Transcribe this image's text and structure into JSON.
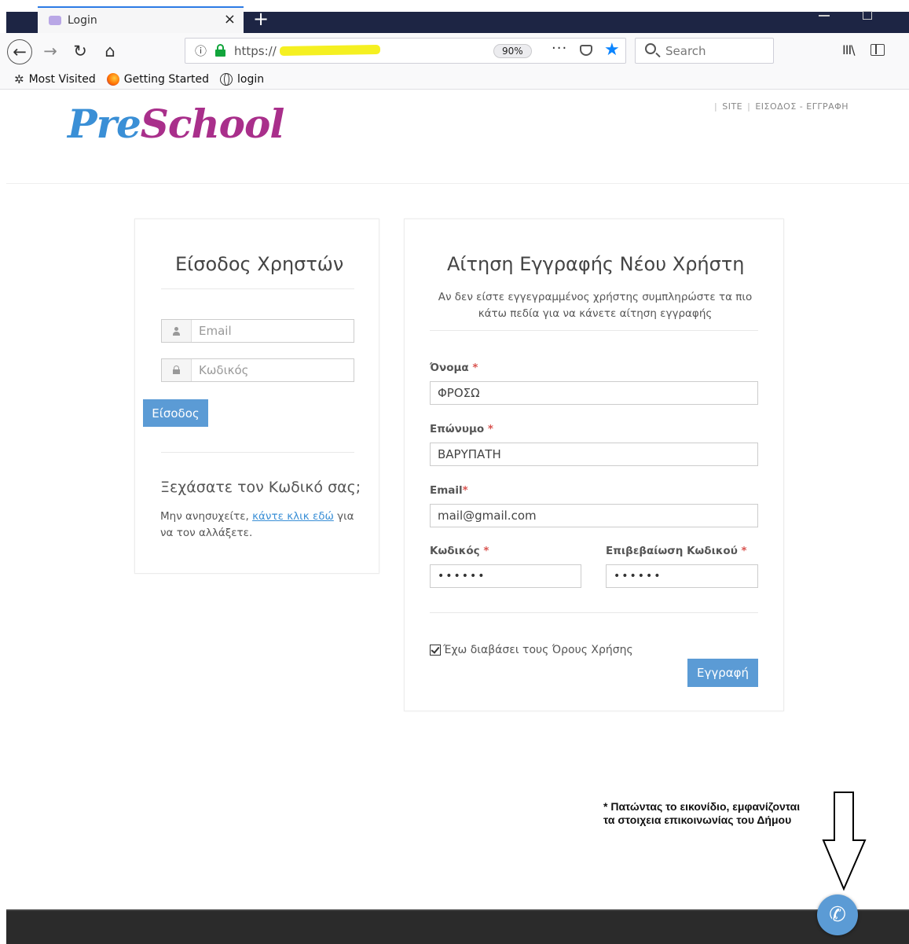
{
  "browser": {
    "tab_title": "Login",
    "tab_close": "×",
    "new_tab": "+",
    "url": "https://",
    "zoom": "90%",
    "more": "···",
    "search_placeholder": "Search",
    "library": "III\\",
    "bookmarks": [
      {
        "label": "Most Visited",
        "icon": "gear-icon"
      },
      {
        "label": "Getting Started",
        "icon": "firefox-icon"
      },
      {
        "label": "login",
        "icon": "globe-icon"
      }
    ]
  },
  "site": {
    "logo_pre": "Pre",
    "logo_school": "Schοοl",
    "nav_site": "SITE",
    "nav_login_register": "ΕΙΣΟΔΟΣ - ΕΓΓΡΑΦΗ"
  },
  "login": {
    "title": "Είσοδος Χρηστών",
    "email_placeholder": "Email",
    "password_placeholder": "Κωδικός",
    "button": "Είσοδος",
    "forgot_title": "Ξεχάσατε τον Κωδικό σας;",
    "forgot_text_before": "Μην ανησυχείτε, ",
    "forgot_link": "κάντε κλικ εδώ",
    "forgot_text_after": " για να τον αλλάξετε."
  },
  "register": {
    "title": "Αίτηση Εγγραφής Νέου Χρήστη",
    "description": "Αν δεν είστε εγγεγραμμένος χρήστης συμπληρώστε τα πιο κάτω πεδία για να κάνετε αίτηση εγγραφής",
    "first_name_label": "Όνομα",
    "first_name_value": "ΦΡΟΣΩ",
    "last_name_label": "Επώνυμο",
    "last_name_value": "ΒΑΡΥΠΑΤΗ",
    "email_label": "Email",
    "email_value": "mail@gmail.com",
    "password_label": "Κωδικός",
    "password_value": "••••••",
    "confirm_label": "Επιβεβαίωση Κωδικού",
    "confirm_value": "••••••",
    "terms_label": "Έχω διαβάσει τους Όρους Χρήσης",
    "terms_checked": true,
    "button": "Εγγραφή",
    "required_mark": "*"
  },
  "annotation": {
    "line1": "* Πατώντας το εικονίδιο, εμφανίζονται",
    "line2": "τα στοιχεια επικοινωνίας του Δήμου"
  },
  "colors": {
    "accent": "#5b9bd5",
    "logo_blue": "#3a8fd6",
    "logo_purple": "#a92f8b",
    "footer": "#2b2b2b"
  }
}
